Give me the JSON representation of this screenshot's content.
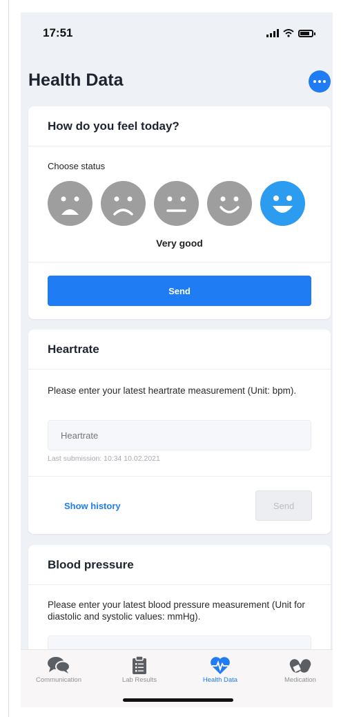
{
  "status_bar": {
    "time": "17:51"
  },
  "page": {
    "title": "Health Data"
  },
  "colors": {
    "accent": "#1f7cf2",
    "selected_face": "#2b9cf0",
    "face_default": "#9e9e9e"
  },
  "feel_card": {
    "title": "How do you feel today?",
    "choose_label": "Choose status",
    "faces": [
      {
        "icon": "very-sad-face-icon"
      },
      {
        "icon": "sad-face-icon"
      },
      {
        "icon": "neutral-face-icon"
      },
      {
        "icon": "happy-face-icon"
      },
      {
        "icon": "very-happy-face-icon",
        "selected": true
      }
    ],
    "selected_label": "Very good",
    "send_label": "Send"
  },
  "heartrate_card": {
    "title": "Heartrate",
    "description": "Please enter your latest heartrate measurement (Unit: bpm).",
    "input_placeholder": "Heartrate",
    "last_submission": "Last submission: 10:34 10.02.2021",
    "history_label": "Show history",
    "send_label": "Send"
  },
  "bp_card": {
    "title": "Blood pressure",
    "description": "Please enter your latest blood pressure measurement (Unit for diastolic and systolic values: mmHg)."
  },
  "tabs": [
    {
      "label": "Communication",
      "icon": "chat-bubbles-icon"
    },
    {
      "label": "Lab Results",
      "icon": "clipboard-icon"
    },
    {
      "label": "Health Data",
      "icon": "heart-pulse-icon",
      "active": true
    },
    {
      "label": "Medication",
      "icon": "pills-icon"
    }
  ]
}
